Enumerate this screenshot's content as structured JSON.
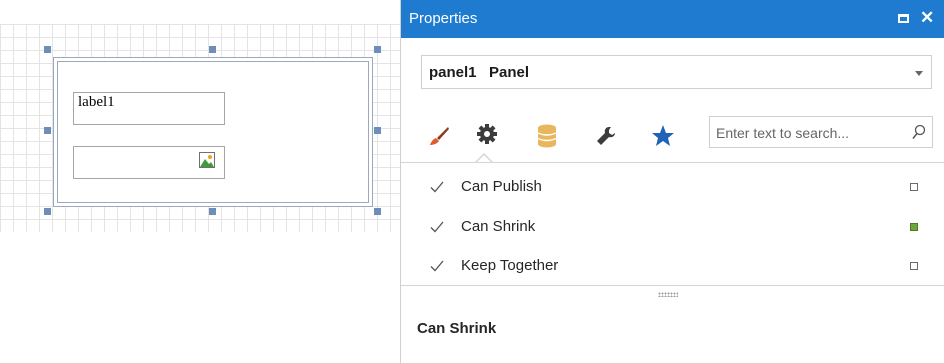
{
  "designer": {
    "label_text": "label1",
    "picture_icon": "picture-icon"
  },
  "properties": {
    "title": "Properties",
    "maximize_icon": "maximize-icon",
    "close_symbol": "✕",
    "selector": {
      "object_name": "panel1",
      "object_type": "Panel"
    },
    "tabs": [
      {
        "icon": "brush-icon"
      },
      {
        "icon": "gear-icon"
      },
      {
        "icon": "database-icon"
      },
      {
        "icon": "wrench-icon"
      },
      {
        "icon": "star-icon"
      }
    ],
    "active_tab": "gear-icon",
    "search": {
      "placeholder": "Enter text to search...",
      "icon": "search-icon"
    },
    "rows": [
      {
        "label": "Can Publish",
        "checked": true,
        "marker": "default"
      },
      {
        "label": "Can Shrink",
        "checked": true,
        "marker": "set"
      },
      {
        "label": "Keep Together",
        "checked": true,
        "marker": "default"
      }
    ],
    "description_title": "Can Shrink"
  },
  "colors": {
    "titlebar": "#1e7bd0",
    "star": "#1e63b7",
    "database": "#e8b65c",
    "brush_tip": "#e05a2b",
    "marker_set": "#6ba73b"
  }
}
